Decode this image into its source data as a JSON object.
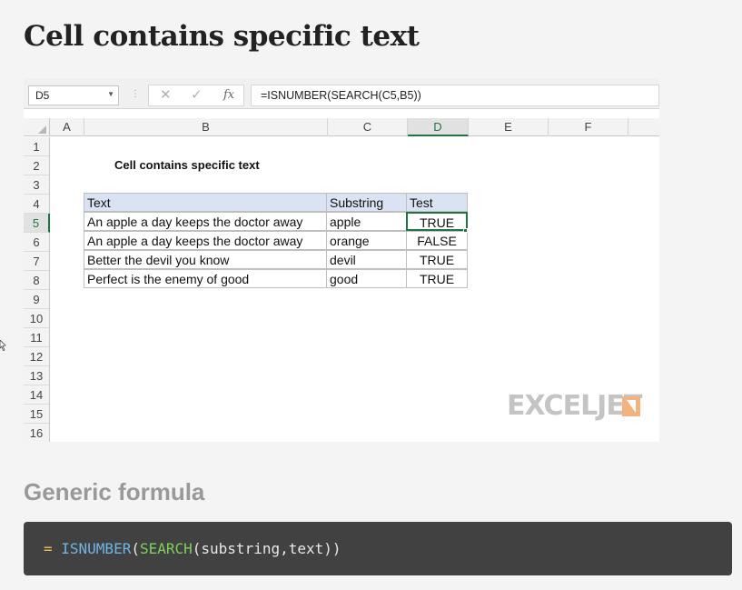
{
  "page": {
    "title": "Cell contains specific text"
  },
  "excel": {
    "namebox": "D5",
    "formula": "=ISNUMBER(SEARCH(C5,B5))",
    "columns": [
      "A",
      "B",
      "C",
      "D",
      "E",
      "F"
    ],
    "active_column": "D",
    "rows": [
      "1",
      "2",
      "3",
      "4",
      "5",
      "6",
      "7",
      "8",
      "9",
      "10",
      "11",
      "12",
      "13",
      "14",
      "15",
      "16"
    ],
    "active_row": "5",
    "sheet_title": "Cell contains specific text",
    "table": {
      "headers": [
        "Text",
        "Substring",
        "Test"
      ],
      "rows": [
        [
          "An apple a day keeps the doctor away",
          "apple",
          "TRUE"
        ],
        [
          "An apple a day keeps the doctor away",
          "orange",
          "FALSE"
        ],
        [
          "Better the devil you know",
          "devil",
          "TRUE"
        ],
        [
          "Perfect is the enemy of good",
          "good",
          "TRUE"
        ]
      ]
    },
    "logo": "EXCELJET"
  },
  "generic": {
    "heading": "Generic formula",
    "eq": "= ",
    "fn1": "ISNUMBER",
    "open1": "(",
    "fn2": "SEARCH",
    "args": "(substring,text))"
  },
  "icons": {
    "cancel": "cancel-icon",
    "enter": "check-icon",
    "fx": "function-icon"
  },
  "colors": {
    "excel_green": "#217346",
    "header_fill": "#dae3f3",
    "code_bg": "#414141",
    "logo_accent": "#f3b37f"
  }
}
